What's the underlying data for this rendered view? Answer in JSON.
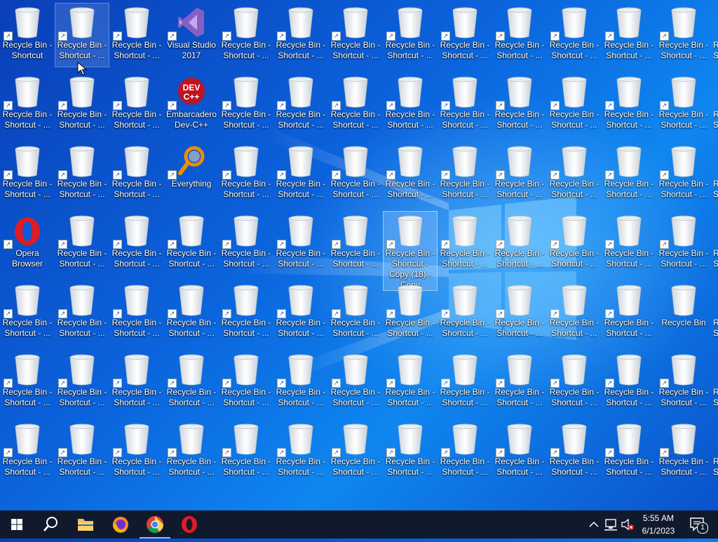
{
  "desktop": {
    "grid": [
      [
        "Recycle Bin - Shortcut",
        "Recycle Bin - Shortcut - ...",
        "Recycle Bin - Shortcut - ...",
        "Visual Studio 2017",
        "Recycle Bin - Shortcut - ...",
        "Recycle Bin - Shortcut - ...",
        "Recycle Bin - Shortcut - ...",
        "Recycle Bin - Shortcut - ...",
        "Recycle Bin - Shortcut - ...",
        "Recycle Bin - Shortcut - ...",
        "Recycle Bin - Shortcut - ...",
        "Recycle Bin - Shortcut - ...",
        "Recycle Bin - Shortcut - ..."
      ],
      [
        "Recycle Bin - Shortcut - ...",
        "Recycle Bin - Shortcut - ...",
        "Recycle Bin - Shortcut - ...",
        "Embarcadero Dev-C++",
        "Recycle Bin - Shortcut - ...",
        "Recycle Bin - Shortcut - ...",
        "Recycle Bin - Shortcut - ...",
        "Recycle Bin - Shortcut - ...",
        "Recycle Bin - Shortcut - ...",
        "Recycle Bin - Shortcut - ...",
        "Recycle Bin - Shortcut - ...",
        "Recycle Bin - Shortcut - ...",
        "Recycle Bin - Shortcut - ..."
      ],
      [
        "Recycle Bin - Shortcut - ...",
        "Recycle Bin - Shortcut - ...",
        "Recycle Bin - Shortcut - ...",
        "Everything",
        "Recycle Bin - Shortcut - ...",
        "Recycle Bin - Shortcut - ...",
        "Recycle Bin - Shortcut - ...",
        "Recycle Bin - Shortcut - ...",
        "Recycle Bin - Shortcut - ...",
        "Recycle Bin - Shortcut - ...",
        "Recycle Bin - Shortcut - ...",
        "Recycle Bin - Shortcut - ...",
        "Recycle Bin - Shortcut - ..."
      ],
      [
        "Opera Browser",
        "Recycle Bin - Shortcut - ...",
        "Recycle Bin - Shortcut - ...",
        "Recycle Bin - Shortcut - ...",
        "Recycle Bin - Shortcut - ...",
        "Recycle Bin - Shortcut - ...",
        "Recycle Bin - Shortcut - ...",
        "Recycle Bin - Shortcut - Copy (18) - Copy",
        "Recycle Bin - Shortcut - ...",
        "Recycle Bin - Shortcut - ...",
        "Recycle Bin - Shortcut - ...",
        "Recycle Bin - Shortcut - ...",
        "Recycle Bin - Shortcut - ..."
      ],
      [
        "Recycle Bin - Shortcut - ...",
        "Recycle Bin - Shortcut - ...",
        "Recycle Bin - Shortcut - ...",
        "Recycle Bin - Shortcut - ...",
        "Recycle Bin - Shortcut - ...",
        "Recycle Bin - Shortcut - ...",
        "Recycle Bin - Shortcut - ...",
        "Recycle Bin - Shortcut - ...",
        "Recycle Bin - Shortcut - ...",
        "Recycle Bin - Shortcut - ...",
        "Recycle Bin - Shortcut - ...",
        "Recycle Bin - Shortcut - ...",
        "Recycle Bin"
      ],
      [
        "Recycle Bin - Shortcut - ...",
        "Recycle Bin - Shortcut - ...",
        "Recycle Bin - Shortcut - ...",
        "Recycle Bin - Shortcut - ...",
        "Recycle Bin - Shortcut - ...",
        "Recycle Bin - Shortcut - ...",
        "Recycle Bin - Shortcut - ...",
        "Recycle Bin - Shortcut - ...",
        "Recycle Bin - Shortcut - ...",
        "Recycle Bin - Shortcut - ...",
        "Recycle Bin - Shortcut - ...",
        "Recycle Bin - Shortcut - ...",
        "Recycle Bin - Shortcut - ..."
      ],
      [
        "Recycle Bin - Shortcut - ...",
        "Recycle Bin - Shortcut - ...",
        "Recycle Bin - Shortcut - ...",
        "Recycle Bin - Shortcut - ...",
        "Recycle Bin - Shortcut - ...",
        "Recycle Bin - Shortcut - ...",
        "Recycle Bin - Shortcut - ...",
        "Recycle Bin - Shortcut - ...",
        "Recycle Bin - Shortcut - ...",
        "Recycle Bin - Shortcut - ...",
        "Recycle Bin - Shortcut - ...",
        "Recycle Bin - Shortcut - ...",
        "Recycle Bin - Shortcut - ..."
      ]
    ],
    "icon_types": {
      "Visual Studio 2017": "visual-studio-icon",
      "Embarcadero Dev-C++": "devcpp-icon",
      "Everything": "everything-search-icon",
      "Opera Browser": "opera-icon",
      "default": "recycle-bin-icon"
    },
    "no_shortcut_arrow": [
      "Recycle Bin"
    ],
    "hovered": {
      "row": 0,
      "col": 1
    },
    "selected": {
      "row": 3,
      "col": 7
    },
    "partial_column_labels": [
      "R",
      "S"
    ]
  },
  "taskbar": {
    "start_icon": "windows-start-icon",
    "search_icon": "search-icon",
    "pinned": [
      {
        "name": "file-explorer",
        "icon": "folder-icon",
        "running": false
      },
      {
        "name": "firefox",
        "icon": "firefox-icon",
        "running": false
      },
      {
        "name": "chrome",
        "icon": "chrome-icon",
        "running": true
      },
      {
        "name": "opera",
        "icon": "opera-icon",
        "running": false
      }
    ],
    "tray_icons": [
      "chevron-up-icon",
      "network-icon",
      "volume-muted-icon"
    ],
    "time": "5:55 AM",
    "date": "6/1/2023",
    "notification_count": "1"
  },
  "colors": {
    "taskbar_bg": "#111a2c",
    "accent": "#8fb8ff"
  }
}
